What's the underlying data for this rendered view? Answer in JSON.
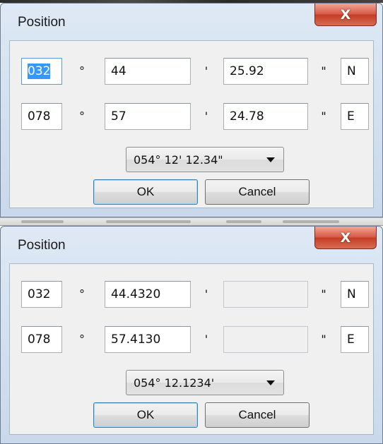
{
  "dialogs": [
    {
      "title": "Position",
      "close_label": "X",
      "rows": [
        {
          "deg": "032",
          "deg_sym": "°",
          "min": "44",
          "min_sym": "'",
          "sec": "25.92",
          "sec_sym": "\"",
          "hemi": "N"
        },
        {
          "deg": "078",
          "deg_sym": "°",
          "min": "57",
          "min_sym": "'",
          "sec": "24.78",
          "sec_sym": "\"",
          "hemi": "E"
        }
      ],
      "format_selected": "054° 12' 12.34\"",
      "ok_label": "OK",
      "cancel_label": "Cancel"
    },
    {
      "title": "Position",
      "close_label": "X",
      "rows": [
        {
          "deg": "032",
          "deg_sym": "°",
          "min": "44.4320",
          "min_sym": "'",
          "sec": "",
          "sec_sym": "\"",
          "hemi": "N"
        },
        {
          "deg": "078",
          "deg_sym": "°",
          "min": "57.4130",
          "min_sym": "'",
          "sec": "",
          "sec_sym": "\"",
          "hemi": "E"
        }
      ],
      "format_selected": "054° 12.1234'",
      "ok_label": "OK",
      "cancel_label": "Cancel"
    }
  ],
  "colors": {
    "selection": "#3399ff",
    "close_button": "#c43c26",
    "dialog_frame": "#d3e1f1"
  }
}
